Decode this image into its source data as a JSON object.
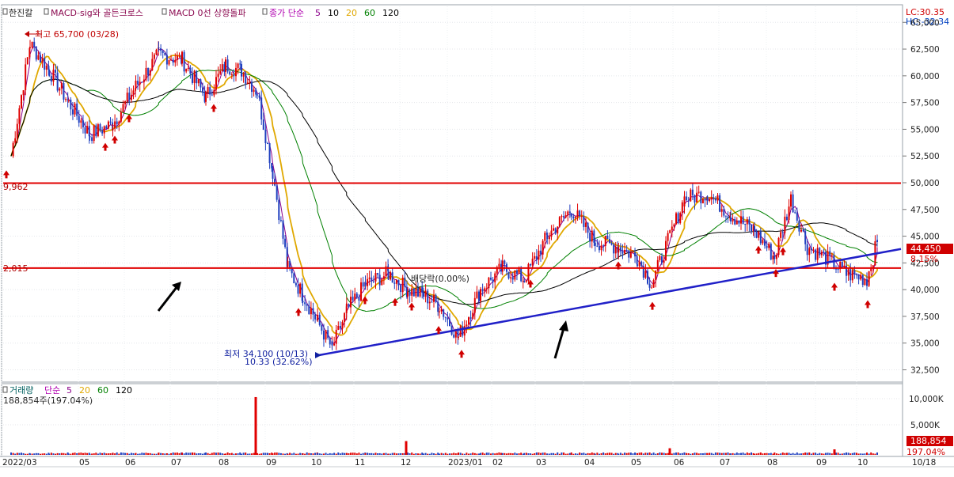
{
  "legend": {
    "stock_name": "한진칼",
    "item_macd_sig": "MACD-sig와 골든크로스",
    "item_macd0": "MACD 0선 상향돌파",
    "item_close_prefix": "종가 단순",
    "periods": [
      "5",
      "10",
      "20",
      "60",
      "120"
    ],
    "period_colors": [
      "#8b008b",
      "#000000",
      "#e0a800",
      "#008000",
      "#000000"
    ]
  },
  "lc_label": "LC:30.35",
  "hc_label": "HC:-32.34",
  "annotations": {
    "high": "최고 65,700 (03/28)",
    "low": "최저 34,100 (10/13)",
    "low_sub": "10.33 (32.62%)",
    "dividend": "배당락(0.00%)",
    "left_49962": "9,962",
    "left_42015": "2,015"
  },
  "price_badge": {
    "value": "44,450",
    "pct": "8.15%"
  },
  "volume_panel": {
    "legend_title": "거래량",
    "legend_prefix": "단순",
    "periods": [
      "5",
      "20",
      "60",
      "120"
    ],
    "period_colors": [
      "#8b008b",
      "#e0a800",
      "#008000",
      "#000000"
    ],
    "current_volume": "188,854주(197.04%)",
    "badge_value": "188,854",
    "badge_pct": "197.04%",
    "y_ticks": [
      "10,000K",
      "5,000K"
    ]
  },
  "x_axis": {
    "labels": [
      "2022/03",
      "05",
      "06",
      "07",
      "08",
      "09",
      "10",
      "11",
      "12",
      "2023/01",
      "02",
      "03",
      "04",
      "05",
      "06",
      "07",
      "08",
      "09",
      "10"
    ],
    "last_label": "10/18"
  },
  "colors": {
    "up": "#e00000",
    "down": "#1f3fbf",
    "resistance": "#e00000",
    "trendline": "#2020c8"
  },
  "chart_data": {
    "type": "candlestick",
    "title": "",
    "ylim": [
      31500,
      66500
    ],
    "y_ticks": [
      32500,
      35000,
      37500,
      40000,
      42500,
      45000,
      47500,
      50000,
      52500,
      55000,
      57500,
      60000,
      62500,
      65000
    ],
    "horizontal_lines": [
      49962,
      42015
    ],
    "trendline": {
      "start": [
        "2022/10",
        33800
      ],
      "end": [
        "2023/10/18",
        43800
      ]
    },
    "price_path": [
      [
        "2022/03",
        52500
      ],
      [
        "2022/03",
        63000
      ],
      [
        "2022/04",
        60500
      ],
      [
        "2022/04",
        57500
      ],
      [
        "2022/05",
        54500
      ],
      [
        "2022/05",
        55500
      ],
      [
        "2022/06",
        59000
      ],
      [
        "2022/06",
        62000
      ],
      [
        "2022/07",
        61500
      ],
      [
        "2022/07",
        58000
      ],
      [
        "2022/08",
        61000
      ],
      [
        "2022/08",
        60500
      ],
      [
        "2022/08",
        58500
      ],
      [
        "2022/09",
        51000
      ],
      [
        "2022/09",
        42000
      ],
      [
        "2022/09",
        39500
      ],
      [
        "2022/10",
        37000
      ],
      [
        "2022/10",
        34500
      ],
      [
        "2022/10",
        38000
      ],
      [
        "2022/11",
        40500
      ],
      [
        "2022/11",
        41500
      ],
      [
        "2022/12",
        40000
      ],
      [
        "2022/12",
        39500
      ],
      [
        "2022/12",
        38500
      ],
      [
        "2023/01",
        35500
      ],
      [
        "2023/01",
        40000
      ],
      [
        "2023/02",
        42000
      ],
      [
        "2023/02",
        41000
      ],
      [
        "2023/03",
        45000
      ],
      [
        "2023/03",
        47500
      ],
      [
        "2023/04",
        44500
      ],
      [
        "2023/04",
        44000
      ],
      [
        "2023/05",
        43000
      ],
      [
        "2023/05",
        40500
      ],
      [
        "2023/05",
        44000
      ],
      [
        "2023/06",
        48500
      ],
      [
        "2023/06",
        49000
      ],
      [
        "2023/07",
        47000
      ],
      [
        "2023/07",
        45500
      ],
      [
        "2023/08",
        43000
      ],
      [
        "2023/08",
        48500
      ],
      [
        "2023/08",
        44000
      ],
      [
        "2023/09",
        43000
      ],
      [
        "2023/09",
        41500
      ],
      [
        "2023/10",
        41000
      ],
      [
        "2023/10/18",
        44450
      ]
    ],
    "volume_spikes": [
      [
        "2022/08",
        10500
      ],
      [
        "2022/12",
        2500
      ],
      [
        "2023/06",
        1200
      ],
      [
        "2023/10",
        1000
      ]
    ]
  }
}
